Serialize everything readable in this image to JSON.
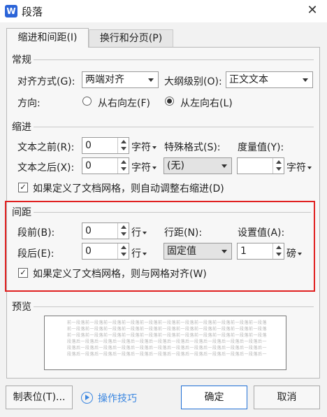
{
  "window": {
    "title": "段落",
    "app_icon_letter": "W"
  },
  "tabs": [
    {
      "label": "缩进和间距(I)",
      "active": true
    },
    {
      "label": "换行和分页(P)",
      "active": false
    }
  ],
  "general": {
    "section_title": "常规",
    "alignment_label": "对齐方式(G):",
    "alignment_value": "两端对齐",
    "outline_label": "大纲级别(O):",
    "outline_value": "正文文本",
    "direction_label": "方向:",
    "rtl_label": "从右向左(F)",
    "ltr_label": "从左向右(L)"
  },
  "indent": {
    "section_title": "缩进",
    "before_label": "文本之前(R):",
    "before_value": "0",
    "before_unit": "字符",
    "after_label": "文本之后(X):",
    "after_value": "0",
    "after_unit": "字符",
    "special_label": "特殊格式(S):",
    "special_value": "(无)",
    "measure_label": "度量值(Y):",
    "measure_value": "",
    "measure_unit": "字符",
    "grid_check_label": "如果定义了文档网格，则自动调整右缩进(D)"
  },
  "spacing": {
    "section_title": "间距",
    "before_label": "段前(B):",
    "before_value": "0",
    "before_unit": "行",
    "after_label": "段后(E):",
    "after_value": "0",
    "after_unit": "行",
    "line_label": "行距(N):",
    "line_value": "固定值",
    "setting_label": "设置值(A):",
    "setting_value": "1",
    "setting_unit": "磅",
    "grid_check_label": "如果定义了文档网格，则与网格对齐(W)"
  },
  "preview": {
    "section_title": "预览",
    "lines": [
      "前一段落前一段落前一段落前一段落前一段落前一段落前一段落前一段落前一段落前一段落前一段落",
      "前一段落前一段落前一段落前一段落前一段落前一段落前一段落前一段落前一段落前一段落前一段落",
      "前一段落前一段落前一段落前一段落前一段落前一段落前一段落前一段落前一段落前一段落前一段落",
      "段落后一段落后一段落后一段落后一段落后一段落后一段落后一段落后一段落后一段落后一段落后一",
      "段落后一段落后一段落后一段落后一段落后一段落后一段落后一段落后一段落后一段落后一段落后一",
      "段落后一段落后一段落后一段落后一段落后一段落后一段落后一段落后一段落后一段落后一段落后一"
    ]
  },
  "buttons": {
    "tabs_label": "制表位(T)...",
    "tips_label": "操作技巧",
    "ok_label": "确定",
    "cancel_label": "取消"
  },
  "colors": {
    "highlight_frame": "#e02020",
    "primary_border": "#1f6fd6",
    "link": "#3a86e0"
  }
}
